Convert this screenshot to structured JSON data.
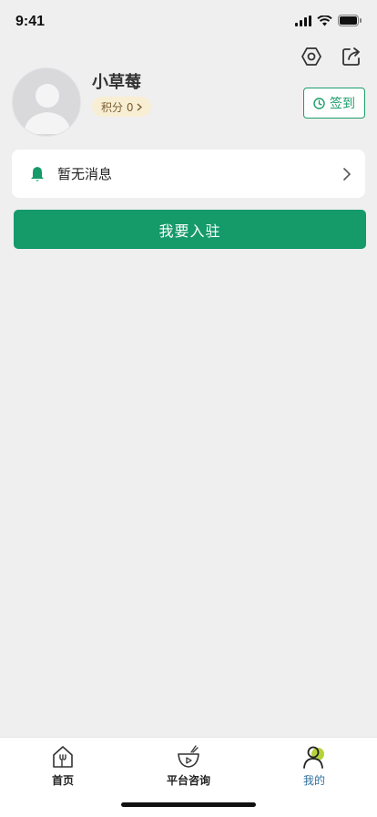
{
  "status_bar": {
    "time": "9:41"
  },
  "profile": {
    "username": "小草莓",
    "points_label": "积分 0",
    "checkin_label": "签到"
  },
  "message": {
    "text": "暂无消息"
  },
  "join_button": {
    "label": "我要入驻"
  },
  "tabs": [
    {
      "label": "首页",
      "icon": "home-icon",
      "active": false
    },
    {
      "label": "平台咨询",
      "icon": "bowl-play-icon",
      "active": false
    },
    {
      "label": "我的",
      "icon": "person-icon",
      "active": true
    }
  ],
  "colors": {
    "accent": "#159a6a",
    "background": "#efefef",
    "points_badge": "#f8eed4",
    "active_tab": "#2e6fa0"
  }
}
